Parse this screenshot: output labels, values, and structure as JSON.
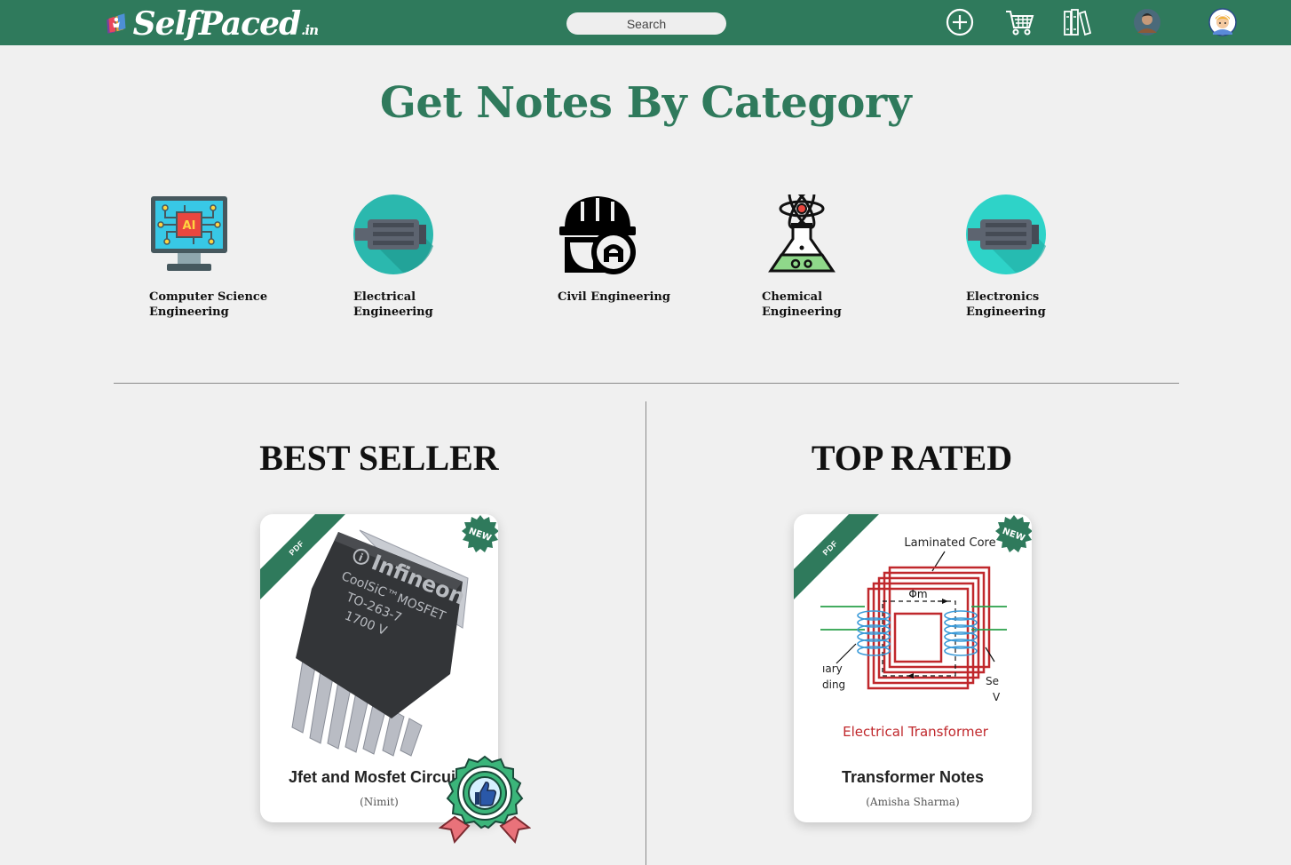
{
  "navbar": {
    "logo_text": "SelfPaced",
    "logo_domain": ".in",
    "search_placeholder": "Search",
    "icons": [
      "add-circle-icon",
      "cart-icon",
      "library-icon",
      "user-avatar",
      "profile-avatar"
    ]
  },
  "page_title": "Get Notes By Category",
  "categories": [
    {
      "label": "Computer Science Engineering",
      "icon": "ai-monitor-icon"
    },
    {
      "label": "Electrical Engineering",
      "icon": "motor-icon"
    },
    {
      "label": "Civil Engineering",
      "icon": "helmet-icon"
    },
    {
      "label": "Chemical Engineering",
      "icon": "flask-icon"
    },
    {
      "label": "Electronics Engineering",
      "icon": "motor-icon"
    }
  ],
  "best_seller": {
    "heading": "BEST SELLER",
    "card": {
      "ribbon": "PDF",
      "badge": "NEW",
      "title": "Jfet and Mosfet Circuits",
      "author": "(Nimit)",
      "image_text": {
        "brand": "Infineon",
        "line1": "CoolSiC™MOSFET",
        "line2": "TO-263-7",
        "line3": "1700 V"
      }
    }
  },
  "top_rated": {
    "heading": "TOP RATED",
    "card": {
      "ribbon": "PDF",
      "badge": "NEW",
      "title": "Transformer Notes",
      "author": "(Amisha Sharma)",
      "image_text": {
        "core": "Laminated Core",
        "flux": "Φm",
        "primary_1": "ıary",
        "primary_2": "ding",
        "secondary_1": "Se",
        "secondary_2": "V",
        "caption": "Electrical Transformer"
      }
    }
  },
  "colors": {
    "brand": "#2f7a5c",
    "background": "#f0f0f0"
  }
}
